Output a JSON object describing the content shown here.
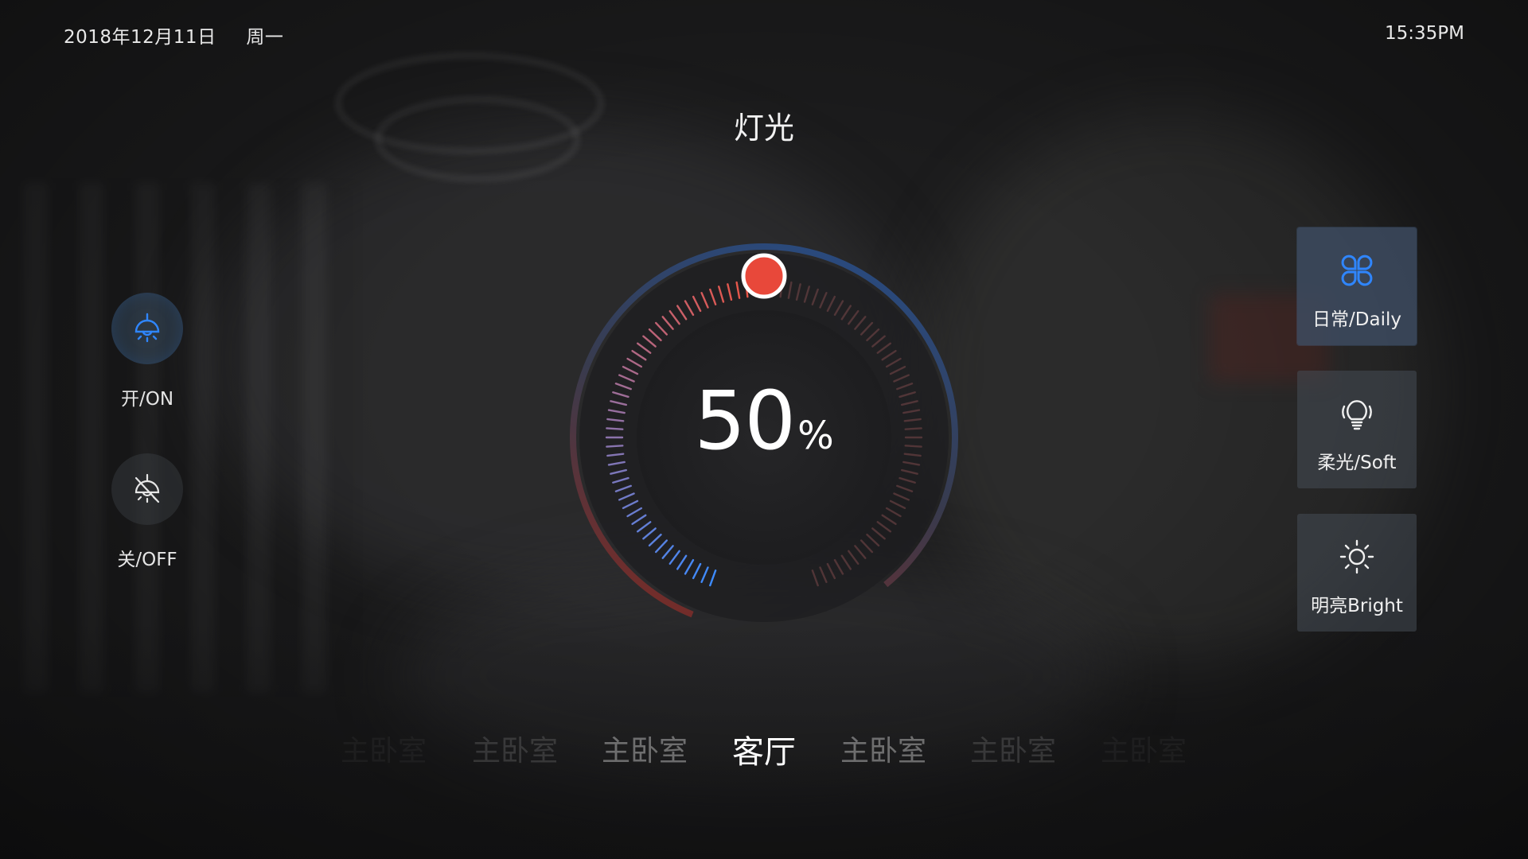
{
  "status": {
    "date": "2018年12月11日",
    "weekday": "周一",
    "time": "15:35PM"
  },
  "title": "灯光",
  "power": {
    "on_label": "开/ON",
    "off_label": "关/OFF",
    "on_icon": "ceiling-lamp-on-icon",
    "off_icon": "ceiling-lamp-off-icon",
    "state": "on"
  },
  "modes": [
    {
      "label": "日常/Daily",
      "icon": "four-petal-grid-icon",
      "active": true
    },
    {
      "label": "柔光/Soft",
      "icon": "lightbulb-icon",
      "active": false
    },
    {
      "label": "明亮Bright",
      "icon": "sun-icon",
      "active": false
    }
  ],
  "dial": {
    "value": "50",
    "unit": "%",
    "level_fraction": 0.5,
    "colors": {
      "cool": "#3d8bff",
      "warm": "#f0533f",
      "knob": "#e8483a",
      "inactive_tick": "#5a3a3c"
    }
  },
  "rooms": [
    {
      "label": "主卧室",
      "active": false
    },
    {
      "label": "主卧室",
      "active": false
    },
    {
      "label": "主卧室",
      "active": false
    },
    {
      "label": "客厅",
      "active": true
    },
    {
      "label": "主卧室",
      "active": false
    },
    {
      "label": "主卧室",
      "active": false
    },
    {
      "label": "主卧室",
      "active": false
    }
  ],
  "colors": {
    "accent_blue": "#2f86ff",
    "text": "#e8e8e8"
  }
}
